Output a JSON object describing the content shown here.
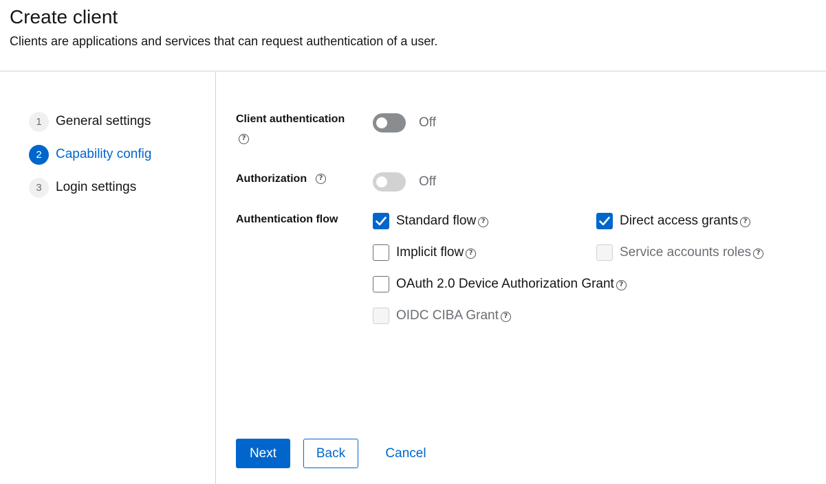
{
  "header": {
    "title": "Create client",
    "subtitle": "Clients are applications and services that can request authentication of a user."
  },
  "wizard_nav": {
    "steps": [
      {
        "number": "1",
        "label": "General settings",
        "active": false
      },
      {
        "number": "2",
        "label": "Capability config",
        "active": true
      },
      {
        "number": "3",
        "label": "Login settings",
        "active": false
      }
    ]
  },
  "form": {
    "client_authentication": {
      "label": "Client authentication",
      "state": "Off",
      "enabled": true
    },
    "authorization": {
      "label": "Authorization",
      "state": "Off",
      "enabled": false
    },
    "authentication_flow": {
      "label": "Authentication flow",
      "options": [
        {
          "label": "Standard flow",
          "checked": true,
          "disabled": false
        },
        {
          "label": "Direct access grants",
          "checked": true,
          "disabled": false
        },
        {
          "label": "Implicit flow",
          "checked": false,
          "disabled": false
        },
        {
          "label": "Service accounts roles",
          "checked": false,
          "disabled": true
        },
        {
          "label": "OAuth 2.0 Device Authorization Grant",
          "checked": false,
          "disabled": false
        },
        {
          "label": "OIDC CIBA Grant",
          "checked": false,
          "disabled": true
        }
      ]
    }
  },
  "actions": {
    "next_label": "Next",
    "back_label": "Back",
    "cancel_label": "Cancel"
  },
  "icons": {
    "help": "question-circle-icon",
    "check": "checkmark-icon"
  },
  "colors": {
    "accent": "#0066cc",
    "switch_off": "#8a8d90",
    "switch_disabled": "#d2d2d2",
    "muted_text": "#6a6e73"
  }
}
